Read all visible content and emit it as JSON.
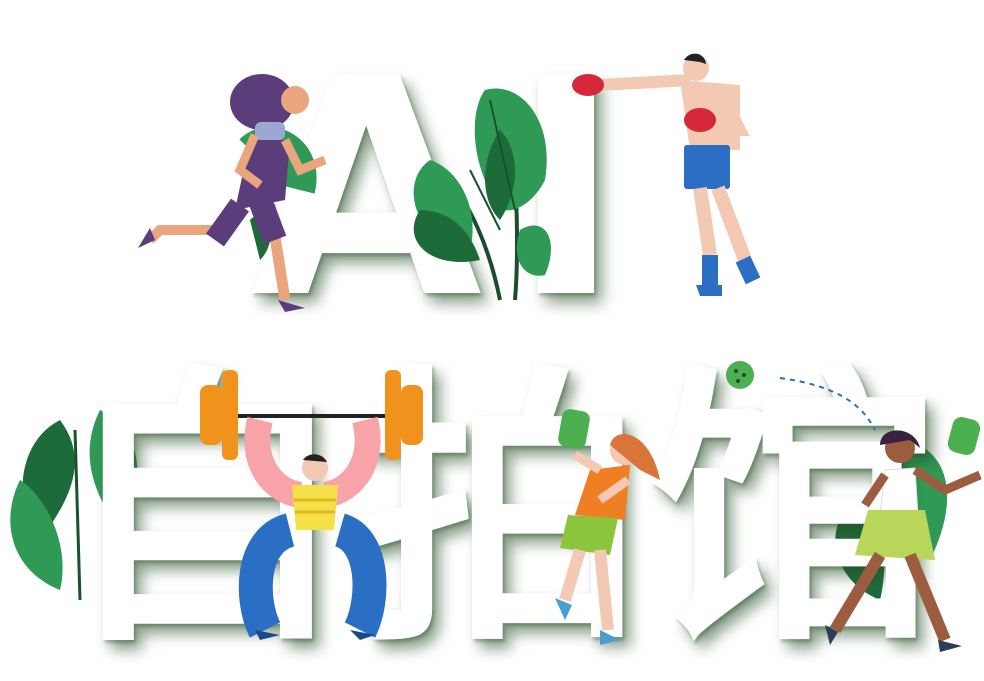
{
  "poster": {
    "line1": "AI",
    "line2": "自拍馆"
  },
  "colors": {
    "leaf_dark": "#1e6b3a",
    "leaf_mid": "#2f9a55",
    "leaf_light": "#5cbf6b",
    "barbell": "#f0921c",
    "runner_hair": "#5a3d7a",
    "boxer_glove": "#d6283a",
    "boxer_shorts": "#2a6fc4",
    "lifter_pants": "#2a6fc4",
    "player_shirt": "#f07f23",
    "skirt": "#8cc43c",
    "paddle": "#4caf50"
  },
  "figures": [
    "runner",
    "boxer",
    "weightlifter",
    "pickleball-player",
    "tennis-player"
  ]
}
